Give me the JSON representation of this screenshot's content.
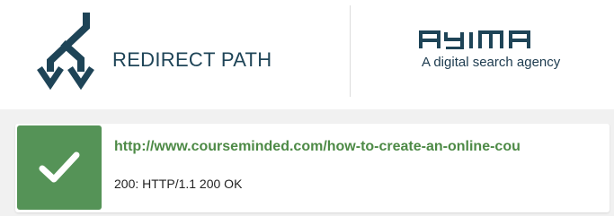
{
  "header": {
    "brand_name": "REDIRECT PATH",
    "logo_icon": "redirect-path-logo-icon",
    "partner": {
      "logo_text": "AYIMA",
      "tagline": "A digital search agency"
    }
  },
  "result": {
    "status_icon": "check-icon",
    "url": "http://www.courseminded.com/how-to-create-an-online-cou",
    "status": "200: HTTP/1.1 200 OK"
  },
  "colors": {
    "brand_navy": "#1e4457",
    "success_green": "#559357",
    "link_green": "#4d8a46",
    "content_background": "#f1f1f1"
  }
}
